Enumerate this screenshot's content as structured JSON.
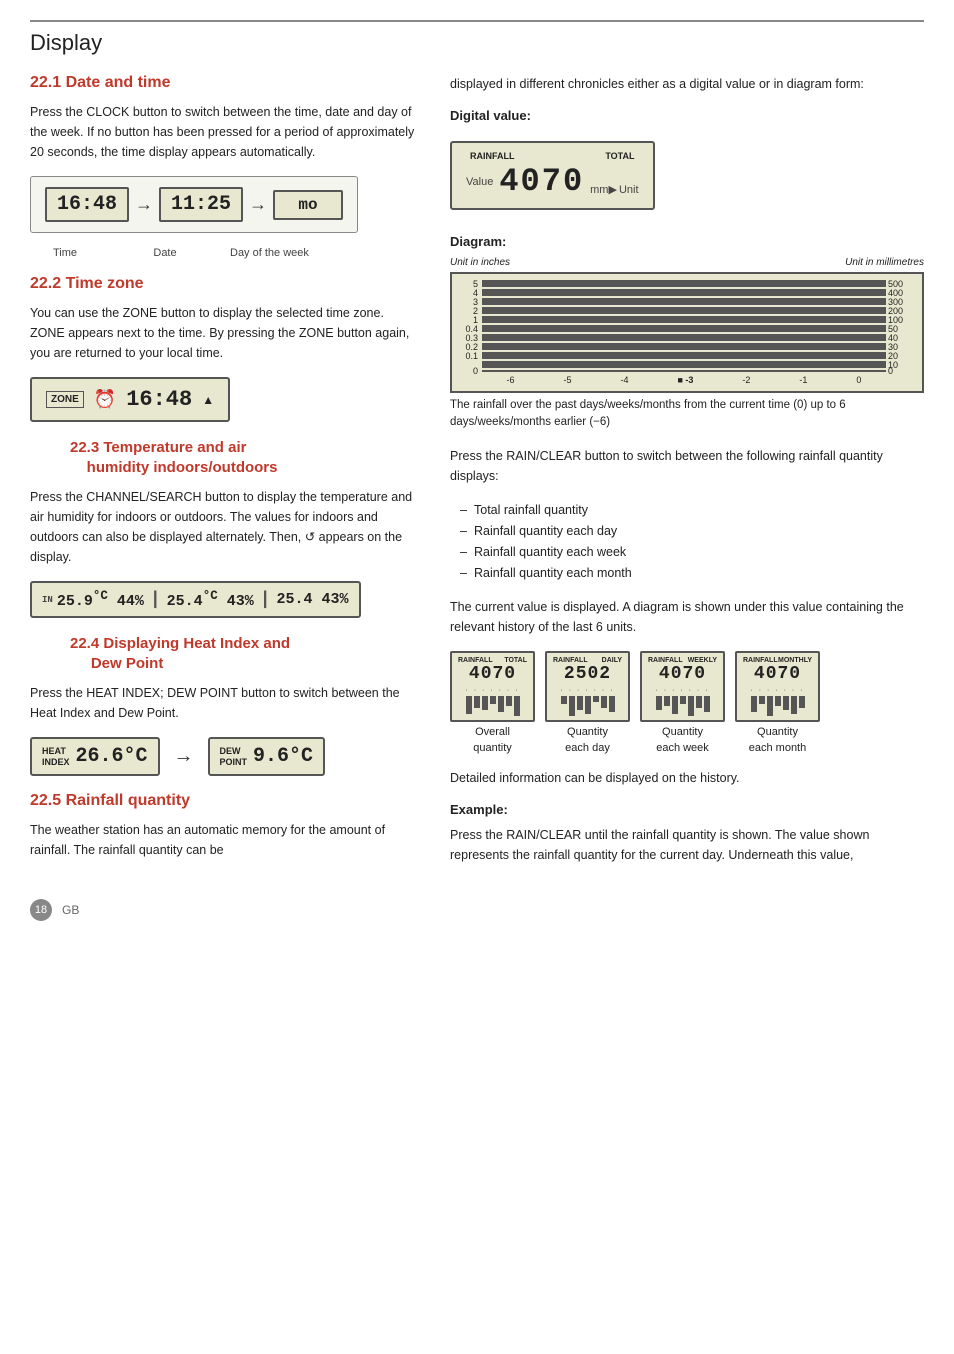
{
  "page": {
    "title": "Display",
    "footer_page": "18",
    "footer_gb": "GB"
  },
  "section_21": {
    "heading": "22.1 Date and time",
    "body": "Press the CLOCK button to switch between the time, date and day of the week. If no button has been pressed for a period of approximately 20 seconds, the time display appears automatically.",
    "displays": [
      {
        "value": "16:48",
        "label": "Time"
      },
      {
        "value": "11:25",
        "label": "Date"
      },
      {
        "value": "mo",
        "label": "Day of the week"
      }
    ]
  },
  "section_22": {
    "heading": "22.2 Time zone",
    "body": "You can use the ZONE button to display the selected time zone. ZONE appears next to the time. By pressing the ZONE button again, you are returned to your local time.",
    "zone_display": "16:48",
    "zone_sup": "▲"
  },
  "section_23": {
    "heading": "22.3 Temperature and air    humidity indoors/outdoors",
    "body": "Press the CHANNEL/SEARCH button to display the temperature and air humidity for indoors or outdoors. The values for indoors and outdoors can also be displayed alternately. Then, ↺ appears on the display.",
    "displays": [
      "25.9°C 44%",
      "25.4°C 43%",
      "25.4 43%"
    ]
  },
  "section_24": {
    "heading": "22.4 Displaying Heat Index and     Dew Point",
    "body": "Press the HEAT INDEX; DEW POINT button to switch between the Heat Index and Dew Point.",
    "heat_value": "26.6°C",
    "dew_value": "9.6°C",
    "heat_label": "HEAT INDEX",
    "dew_label": "DEW POINT"
  },
  "section_25": {
    "heading": "22.5 Rainfall quantity",
    "body": "The weather station has an automatic memory for the amount of rainfall. The rainfall quantity can be"
  },
  "right": {
    "body_continued": "displayed in different chronicles either as a digital value or in diagram form:",
    "digital_heading": "Digital value:",
    "digital_top_labels": [
      "RAINFALL",
      "TOTAL"
    ],
    "digital_value": "4070",
    "digital_value_label": "Value",
    "digital_unit": "mm▶",
    "unit_label": "Unit",
    "diagram_heading": "Diagram:",
    "diagram_axis_left": "Unit in inches",
    "diagram_axis_right": "Unit in millimetres",
    "diagram_y_left": [
      "5",
      "4",
      "3",
      "2",
      "1",
      "0.4",
      "0.3",
      "0.2",
      "0.1",
      "0"
    ],
    "diagram_y_right": [
      "500",
      "400",
      "300",
      "200",
      "100",
      "50",
      "40",
      "30",
      "20",
      "10",
      "0"
    ],
    "diagram_x": [
      "-6",
      "-5",
      "-4",
      "-3",
      "-2",
      "-1",
      "0"
    ],
    "diagram_caption": "The rainfall over the past days/weeks/months from the current time (0) up to 6 days/weeks/months earlier (−6)",
    "rain_clear_text": "Press the RAIN/CLEAR button to switch between the following rainfall quantity displays:",
    "rain_list": [
      "Total rainfall quantity",
      "Rainfall quantity each day",
      "Rainfall quantity each week",
      "Rainfall quantity each month"
    ],
    "history_text": "The current value is displayed. A diagram is shown under this value containing the relevant history of the last 6 units.",
    "displays": [
      {
        "top1": "RAINFALL",
        "top2": "TOTAL",
        "value": "4070",
        "label1": "Overall",
        "label2": "quantity"
      },
      {
        "top1": "RAINFALL",
        "top2": "DAILY",
        "value": "2502",
        "label1": "Quantity",
        "label2": "each day"
      },
      {
        "top1": "RAINFALL",
        "top2": "WEEKLY",
        "value": "4070",
        "label1": "Quantity",
        "label2": "each week"
      },
      {
        "top1": "RAINFALL",
        "top2": "MONTHLY",
        "value": "4070",
        "label1": "Quantity",
        "label2": "each month"
      }
    ],
    "detailed_info": "Detailed information can be displayed on the history.",
    "example_heading": "Example:",
    "example_text": "Press the RAIN/CLEAR until the rainfall quantity is shown. The value shown represents the rainfall quantity for the current day. Underneath this value,"
  }
}
